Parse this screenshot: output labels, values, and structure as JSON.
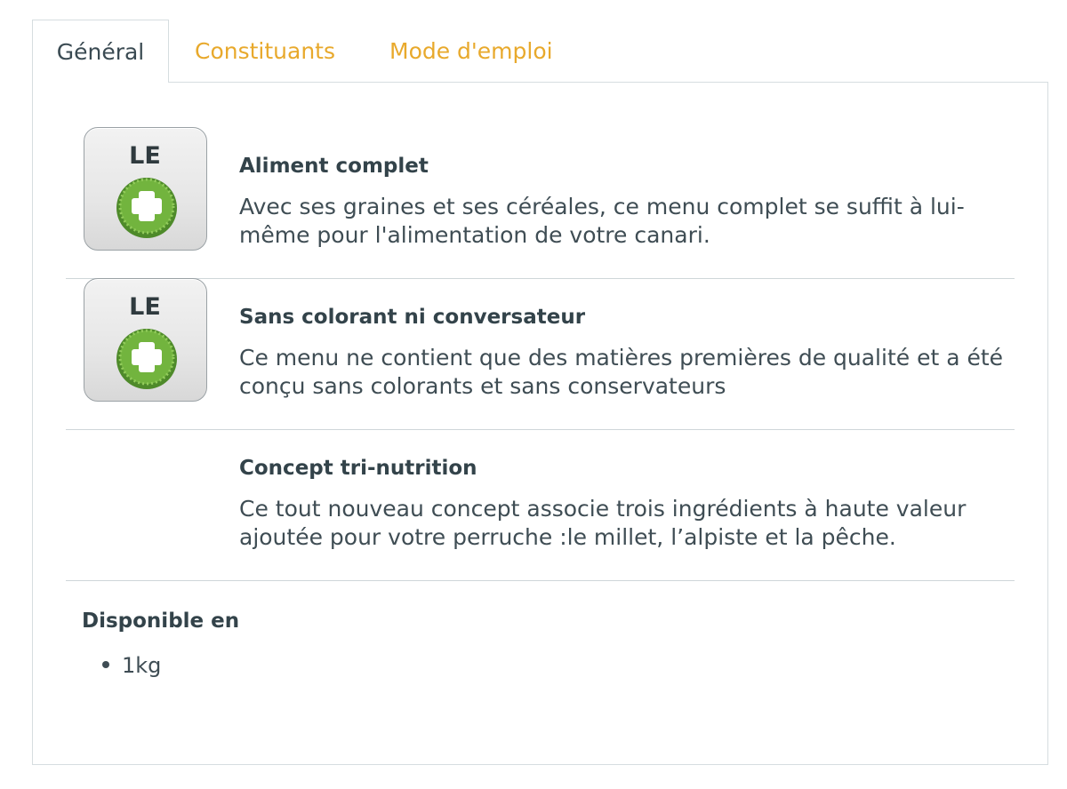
{
  "tabs": [
    {
      "label": "Général",
      "active": true
    },
    {
      "label": "Constituants",
      "active": false
    },
    {
      "label": "Mode d'emploi",
      "active": false
    }
  ],
  "features": [
    {
      "badge": {
        "text": "LE",
        "icon": "green-plus-badge-icon"
      },
      "title": "Aliment complet",
      "description": "Avec ses graines et ses céréales, ce menu complet se suffit à lui-même pour l'alimentation de votre canari."
    },
    {
      "badge": {
        "text": "LE",
        "icon": "green-plus-badge-icon"
      },
      "title": "Sans colorant ni conversateur",
      "description": "Ce menu ne contient que des matières premières de qualité et a été conçu sans colorants et sans conservateurs"
    },
    {
      "title": "Concept tri-nutrition",
      "description": "Ce tout nouveau concept associe trois ingrédients à haute valeur ajoutée pour votre perruche :le millet, l’alpiste et la pêche."
    }
  ],
  "availability": {
    "title": "Disponible en",
    "items": [
      "1kg"
    ]
  },
  "colors": {
    "link": "#e8a92c",
    "badge_green": "#6cae3c",
    "border": "#d6dde0"
  }
}
